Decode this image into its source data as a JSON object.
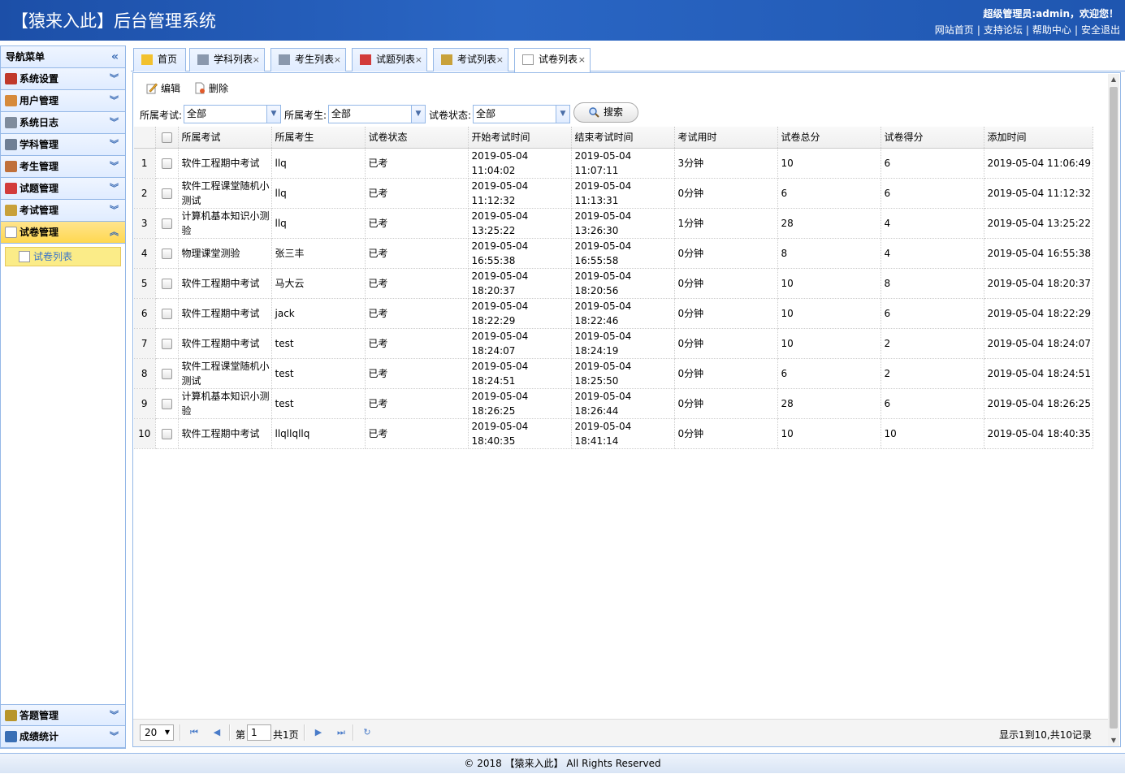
{
  "header": {
    "title": "【猿来入此】后台管理系统",
    "welcome": "超级管理员:admin，欢迎您！",
    "links": [
      "网站首页",
      "支持论坛",
      "帮助中心",
      "安全退出"
    ],
    "sep": "|"
  },
  "sidebar": {
    "title": "导航菜单",
    "collapse_icon": "«",
    "items": [
      {
        "label": "系统设置",
        "icon": "tools-icon",
        "color": "#c0392b"
      },
      {
        "label": "用户管理",
        "icon": "users-icon",
        "color": "#d68a3a"
      },
      {
        "label": "系统日志",
        "icon": "log-icon",
        "color": "#7f8c9d"
      },
      {
        "label": "学科管理",
        "icon": "list-icon",
        "color": "#6f7f95"
      },
      {
        "label": "考生管理",
        "icon": "students-icon",
        "color": "#c0703a"
      },
      {
        "label": "试题管理",
        "icon": "calendar-icon",
        "color": "#d23b3b"
      },
      {
        "label": "考试管理",
        "icon": "chart-icon",
        "color": "#c8a13a"
      },
      {
        "label": "试卷管理",
        "icon": "papers-icon",
        "color": "#ffffff"
      }
    ],
    "active_sub": "试卷列表",
    "bottom": [
      {
        "label": "答题管理",
        "icon": "pencil-icon",
        "color": "#b8952a"
      },
      {
        "label": "成绩统计",
        "icon": "headset-icon",
        "color": "#3a6fb5"
      }
    ]
  },
  "tabs": [
    {
      "label": "首页",
      "icon": "bulb-icon",
      "color": "#f2c12e",
      "closable": false
    },
    {
      "label": "学科列表",
      "icon": "list-icon",
      "color": "#8a98ad",
      "closable": true
    },
    {
      "label": "考生列表",
      "icon": "card-icon",
      "color": "#8a98ad",
      "closable": true
    },
    {
      "label": "试题列表",
      "icon": "calendar-icon",
      "color": "#d23b3b",
      "closable": true
    },
    {
      "label": "考试列表",
      "icon": "chart-icon",
      "color": "#c8a13a",
      "closable": true
    },
    {
      "label": "试卷列表",
      "icon": "papers-icon",
      "color": "#ffffff",
      "closable": true
    }
  ],
  "toolbar": {
    "edit": "编辑",
    "delete": "删除"
  },
  "filters": {
    "exam_label": "所属考试:",
    "exam_value": "全部",
    "student_label": "所属考生:",
    "student_value": "全部",
    "status_label": "试卷状态:",
    "status_value": "全部",
    "search": "搜索"
  },
  "columns": [
    "所属考试",
    "所属考生",
    "试卷状态",
    "开始考试时间",
    "结束考试时间",
    "考试用时",
    "试卷总分",
    "试卷得分",
    "添加时间"
  ],
  "rows": [
    {
      "n": "1",
      "exam": "软件工程期中考试",
      "student": "llq",
      "status": "已考",
      "start": [
        "2019-05-04",
        "11:04:02"
      ],
      "end": [
        "2019-05-04",
        "11:07:11"
      ],
      "dur": "3分钟",
      "total": "10",
      "score": "6",
      "added": "2019-05-04 11:06:49"
    },
    {
      "n": "2",
      "exam": "软件工程课堂随机小测试",
      "student": "llq",
      "status": "已考",
      "start": [
        "2019-05-04",
        "11:12:32"
      ],
      "end": [
        "2019-05-04",
        "11:13:31"
      ],
      "dur": "0分钟",
      "total": "6",
      "score": "6",
      "added": "2019-05-04 11:12:32"
    },
    {
      "n": "3",
      "exam": "计算机基本知识小测验",
      "student": "llq",
      "status": "已考",
      "start": [
        "2019-05-04",
        "13:25:22"
      ],
      "end": [
        "2019-05-04",
        "13:26:30"
      ],
      "dur": "1分钟",
      "total": "28",
      "score": "4",
      "added": "2019-05-04 13:25:22"
    },
    {
      "n": "4",
      "exam": "物理课堂测验",
      "student": "张三丰",
      "status": "已考",
      "start": [
        "2019-05-04",
        "16:55:38"
      ],
      "end": [
        "2019-05-04",
        "16:55:58"
      ],
      "dur": "0分钟",
      "total": "8",
      "score": "4",
      "added": "2019-05-04 16:55:38"
    },
    {
      "n": "5",
      "exam": "软件工程期中考试",
      "student": "马大云",
      "status": "已考",
      "start": [
        "2019-05-04",
        "18:20:37"
      ],
      "end": [
        "2019-05-04",
        "18:20:56"
      ],
      "dur": "0分钟",
      "total": "10",
      "score": "8",
      "added": "2019-05-04 18:20:37"
    },
    {
      "n": "6",
      "exam": "软件工程期中考试",
      "student": "jack",
      "status": "已考",
      "start": [
        "2019-05-04",
        "18:22:29"
      ],
      "end": [
        "2019-05-04",
        "18:22:46"
      ],
      "dur": "0分钟",
      "total": "10",
      "score": "6",
      "added": "2019-05-04 18:22:29"
    },
    {
      "n": "7",
      "exam": "软件工程期中考试",
      "student": "test",
      "status": "已考",
      "start": [
        "2019-05-04",
        "18:24:07"
      ],
      "end": [
        "2019-05-04",
        "18:24:19"
      ],
      "dur": "0分钟",
      "total": "10",
      "score": "2",
      "added": "2019-05-04 18:24:07"
    },
    {
      "n": "8",
      "exam": "软件工程课堂随机小测试",
      "student": "test",
      "status": "已考",
      "start": [
        "2019-05-04",
        "18:24:51"
      ],
      "end": [
        "2019-05-04",
        "18:25:50"
      ],
      "dur": "0分钟",
      "total": "6",
      "score": "2",
      "added": "2019-05-04 18:24:51"
    },
    {
      "n": "9",
      "exam": "计算机基本知识小测验",
      "student": "test",
      "status": "已考",
      "start": [
        "2019-05-04",
        "18:26:25"
      ],
      "end": [
        "2019-05-04",
        "18:26:44"
      ],
      "dur": "0分钟",
      "total": "28",
      "score": "6",
      "added": "2019-05-04 18:26:25"
    },
    {
      "n": "10",
      "exam": "软件工程期中考试",
      "student": "llqllqllq",
      "status": "已考",
      "start": [
        "2019-05-04",
        "18:40:35"
      ],
      "end": [
        "2019-05-04",
        "18:41:14"
      ],
      "dur": "0分钟",
      "total": "10",
      "score": "10",
      "added": "2019-05-04 18:40:35"
    }
  ],
  "pager": {
    "page_size": "20",
    "page_prefix": "第",
    "page_num": "1",
    "page_total": "共1页",
    "summary": "显示1到10,共10记录"
  },
  "footer": "© 2018 【猿来入此】 All Rights Reserved"
}
